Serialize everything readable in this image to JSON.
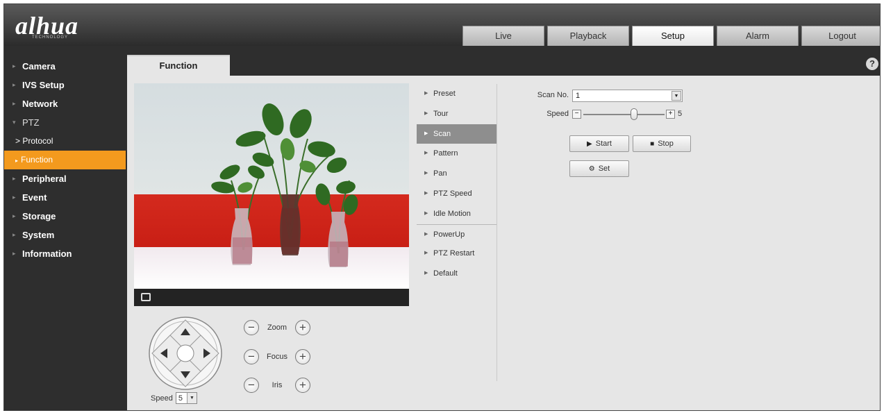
{
  "header": {
    "logo": "alhua",
    "logo_sub": "TECHNOLOGY",
    "tabs": [
      {
        "label": "Live"
      },
      {
        "label": "Playback"
      },
      {
        "label": "Setup"
      },
      {
        "label": "Alarm"
      },
      {
        "label": "Logout"
      }
    ],
    "active_tab": "Setup"
  },
  "sidebar": {
    "items": [
      {
        "label": "Camera"
      },
      {
        "label": "IVS Setup"
      },
      {
        "label": "Network"
      },
      {
        "label": "PTZ"
      },
      {
        "label": "> Protocol"
      },
      {
        "label": "Function"
      },
      {
        "label": "Peripheral"
      },
      {
        "label": "Event"
      },
      {
        "label": "Storage"
      },
      {
        "label": "System"
      },
      {
        "label": "Information"
      }
    ],
    "active_item": "Function",
    "accent_color": "#f39a1e"
  },
  "content": {
    "tab_label": "Function",
    "help_label": "?"
  },
  "video": {
    "osd_top": "",
    "osd_bottom": ""
  },
  "ptz_controls": {
    "speed_label": "Speed",
    "speed_value": "5",
    "zoom_label": "Zoom",
    "focus_label": "Focus",
    "iris_label": "Iris",
    "minus": "−",
    "plus": "+"
  },
  "function_menu": {
    "items": [
      {
        "label": "Preset"
      },
      {
        "label": "Tour"
      },
      {
        "label": "Scan"
      },
      {
        "label": "Pattern"
      },
      {
        "label": "Pan"
      },
      {
        "label": "PTZ Speed"
      },
      {
        "label": "Idle Motion"
      },
      {
        "label": "PowerUp"
      },
      {
        "label": "PTZ Restart"
      },
      {
        "label": "Default"
      }
    ],
    "active_item": "Scan"
  },
  "scan": {
    "scan_no_label": "Scan No.",
    "scan_no_value": "1",
    "speed_label": "Speed",
    "speed_minus": "−",
    "speed_plus": "+",
    "speed_value": "5",
    "speed_level": 0.62,
    "start_label": "Start",
    "stop_label": "Stop",
    "set_label": "Set"
  }
}
